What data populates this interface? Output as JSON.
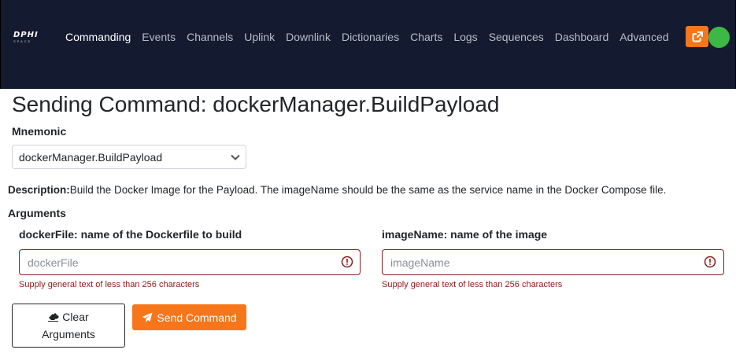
{
  "brand": {
    "logo_text": "DPHI",
    "logo_subtext": "SPACE"
  },
  "nav": {
    "items": [
      {
        "label": "Commanding",
        "active": true
      },
      {
        "label": "Events",
        "active": false
      },
      {
        "label": "Channels",
        "active": false
      },
      {
        "label": "Uplink",
        "active": false
      },
      {
        "label": "Downlink",
        "active": false
      },
      {
        "label": "Dictionaries",
        "active": false
      },
      {
        "label": "Charts",
        "active": false
      },
      {
        "label": "Logs",
        "active": false
      },
      {
        "label": "Sequences",
        "active": false
      },
      {
        "label": "Dashboard",
        "active": false
      },
      {
        "label": "Advanced",
        "active": false
      }
    ],
    "external_button_icon": "external-link-icon",
    "status_color": "#3cb847"
  },
  "page": {
    "title": "Sending Command: dockerManager.BuildPayload",
    "mnemonic_label": "Mnemonic",
    "mnemonic_value": "dockerManager.BuildPayload",
    "description_label": "Description:",
    "description_text": "Build the Docker Image for the Payload. The imageName should be the same as the service name in the Docker Compose file.",
    "arguments_label": "Arguments"
  },
  "arguments": [
    {
      "label": "dockerFile: name of the Dockerfile to build",
      "placeholder": "dockerFile",
      "value": "",
      "help": "Supply general text of less than 256 characters"
    },
    {
      "label": "imageName: name of the image",
      "placeholder": "imageName",
      "value": "",
      "help": "Supply general text of less than 256 characters"
    }
  ],
  "buttons": {
    "clear_line1": "Clear",
    "clear_line2": "Arguments",
    "send": "Send Command"
  },
  "colors": {
    "accent": "#f7761b",
    "navbar": "#141a30",
    "error": "#8b1a1a"
  }
}
